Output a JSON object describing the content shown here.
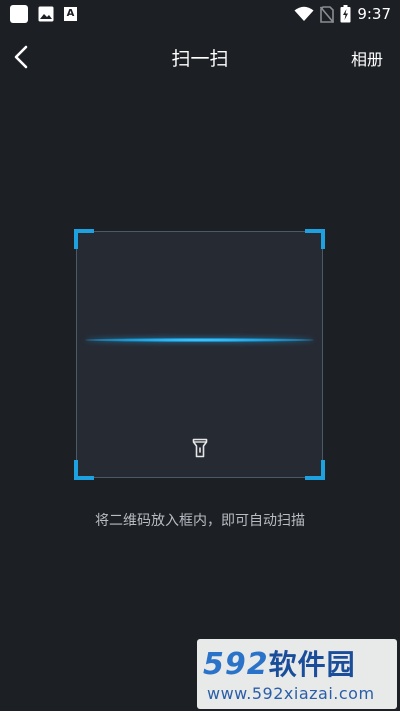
{
  "status_bar": {
    "time": "9:37",
    "icons": [
      "app-icon",
      "gallery-icon",
      "font-icon",
      "wifi-icon",
      "no-sim-icon",
      "battery-charging-icon"
    ]
  },
  "app_bar": {
    "title": "扫一扫",
    "album_label": "相册",
    "back_icon": "chevron-left-icon"
  },
  "scanner": {
    "hint": "将二维码放入框内，即可自动扫描",
    "flashlight_icon": "flashlight-icon",
    "accent_color": "#1da1e0"
  },
  "watermark": {
    "number": "592",
    "brand": "软件园",
    "url": "www.592xiazai.com"
  },
  "colors": {
    "background": "#1c1f24",
    "frame": "#262a33",
    "hint": "#b9bcc2"
  }
}
